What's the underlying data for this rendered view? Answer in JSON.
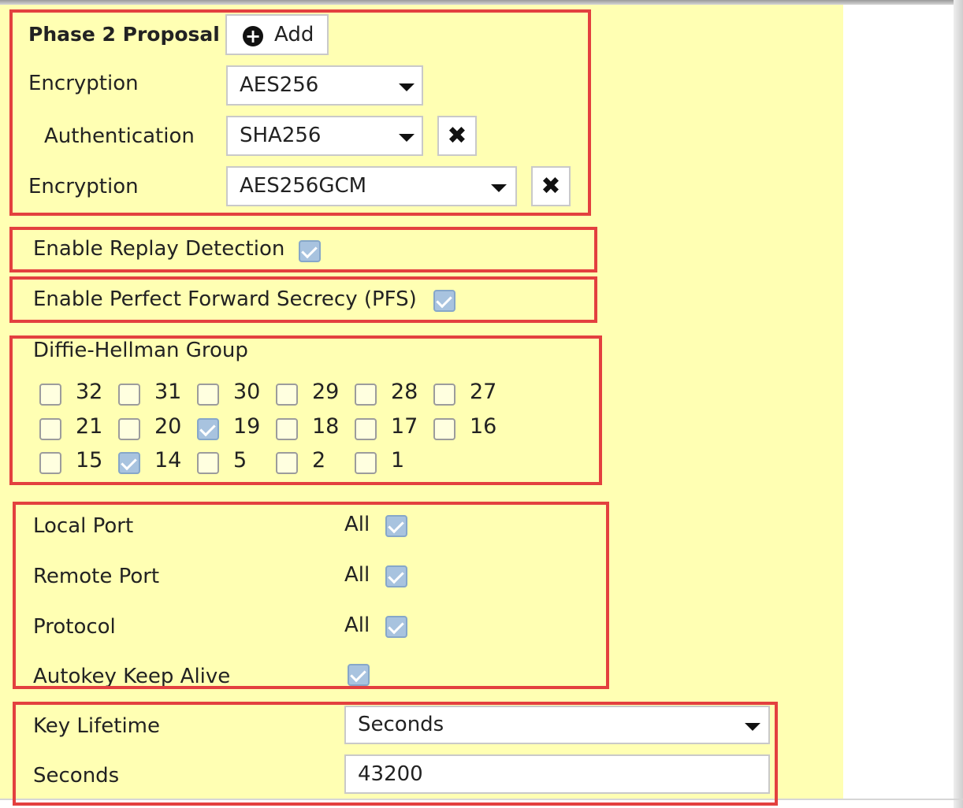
{
  "phase2": {
    "title": "Phase 2 Proposal",
    "add_label": "Add",
    "rows": [
      {
        "label": "Encryption",
        "value": "AES256"
      },
      {
        "label": "Authentication",
        "value": "SHA256"
      },
      {
        "label": "Encryption",
        "value": "AES256GCM"
      }
    ]
  },
  "replay": {
    "label": "Enable Replay Detection",
    "checked": true
  },
  "pfs": {
    "label": "Enable Perfect Forward Secrecy (PFS)",
    "checked": true
  },
  "dh": {
    "title": "Diffie-Hellman Group",
    "groups": [
      {
        "num": "32",
        "checked": false
      },
      {
        "num": "31",
        "checked": false
      },
      {
        "num": "30",
        "checked": false
      },
      {
        "num": "29",
        "checked": false
      },
      {
        "num": "28",
        "checked": false
      },
      {
        "num": "27",
        "checked": false
      },
      {
        "num": "21",
        "checked": false
      },
      {
        "num": "20",
        "checked": false
      },
      {
        "num": "19",
        "checked": true
      },
      {
        "num": "18",
        "checked": false
      },
      {
        "num": "17",
        "checked": false
      },
      {
        "num": "16",
        "checked": false
      },
      {
        "num": "15",
        "checked": false
      },
      {
        "num": "14",
        "checked": true
      },
      {
        "num": "5",
        "checked": false
      },
      {
        "num": "2",
        "checked": false
      },
      {
        "num": "1",
        "checked": false
      }
    ]
  },
  "ports": {
    "local_port": {
      "label": "Local Port",
      "all": "All",
      "checked": true
    },
    "remote_port": {
      "label": "Remote Port",
      "all": "All",
      "checked": true
    },
    "protocol": {
      "label": "Protocol",
      "all": "All",
      "checked": true
    },
    "autokey": {
      "label": "Autokey Keep Alive",
      "checked": true
    }
  },
  "lifetime": {
    "label": "Key Lifetime",
    "value": "Seconds",
    "seconds_label": "Seconds",
    "seconds_value": "43200"
  },
  "colors": {
    "panel_bg": "#ffffb3",
    "highlight_border": "#e3403f",
    "checkbox_checked": "#a8c3df"
  }
}
